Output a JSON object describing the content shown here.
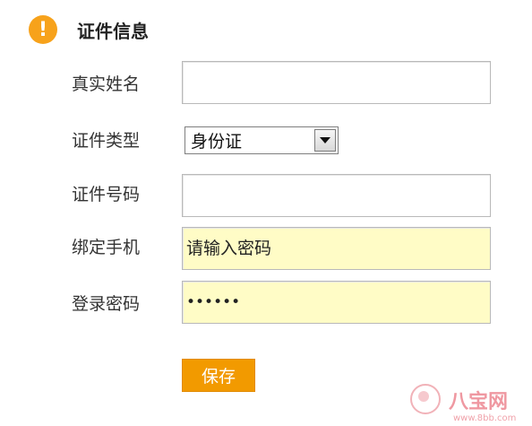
{
  "header": {
    "icon": "exclamation-circle-icon",
    "title": "证件信息"
  },
  "form": {
    "real_name_label": "真实姓名",
    "real_name_value": "",
    "id_type_label": "证件类型",
    "id_type_value": "身份证",
    "id_number_label": "证件号码",
    "id_number_value": "",
    "phone_label": "绑定手机",
    "phone_placeholder": "请输入密码",
    "password_label": "登录密码",
    "password_value": "••••••",
    "save_label": "保存"
  },
  "watermark": {
    "brand": "八宝网",
    "url": "www.8bb.com"
  },
  "colors": {
    "accent": "#f29a00",
    "icon": "#f7a21b",
    "input_highlight": "#fffcc6"
  }
}
